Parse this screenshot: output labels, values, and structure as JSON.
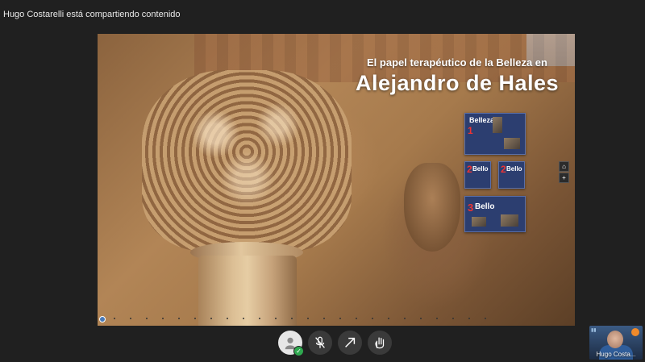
{
  "banner": {
    "sharing_text": "Hugo Costarelli está compartiendo contenido"
  },
  "presentation": {
    "title_line1": "El papel terapéutico de la Belleza en",
    "title_line2": "Alejandro de Hales",
    "thumbnails": [
      {
        "number": "1",
        "label": "Belleza"
      },
      {
        "number": "2",
        "label": "Bello"
      },
      {
        "number": "2",
        "label": "Bello"
      },
      {
        "number": "3",
        "label": "Bello"
      }
    ],
    "nav": {
      "home_icon": "home-icon",
      "zoom_icon": "zoom-in-icon"
    }
  },
  "controls": [
    {
      "name": "user-avatar-button",
      "icon": "user-icon"
    },
    {
      "name": "mute-microphone-button",
      "icon": "microphone-off-icon"
    },
    {
      "name": "share-screen-button",
      "icon": "share-arrow-icon"
    },
    {
      "name": "hand-raise-button",
      "icon": "hand-icon"
    }
  ],
  "webcam": {
    "name": "Hugo Costa..."
  },
  "colors": {
    "background": "#202020",
    "thumbnail_bg": "#2c3e70",
    "status_green": "#2fa84f",
    "accent_red": "#e33"
  }
}
